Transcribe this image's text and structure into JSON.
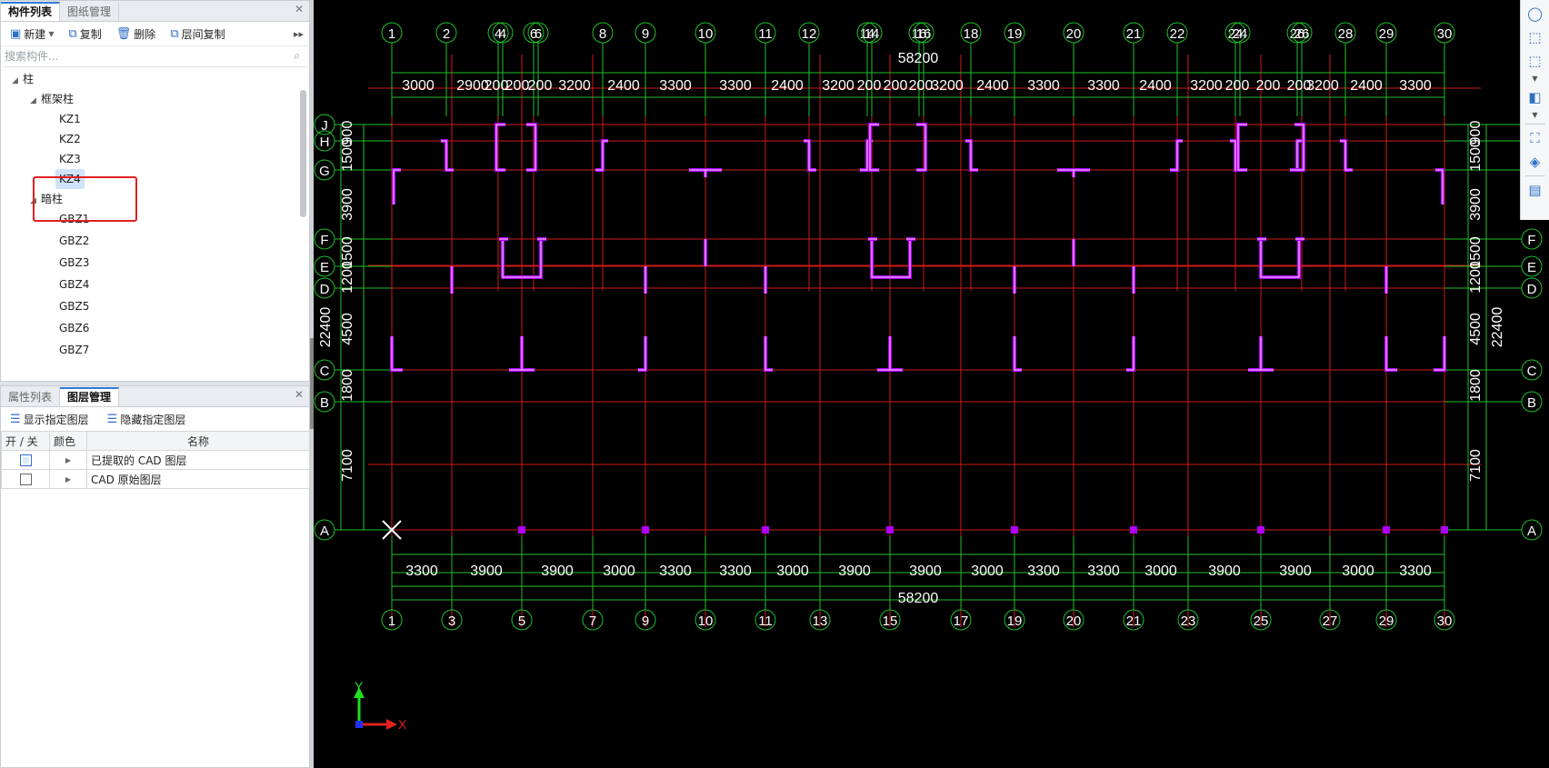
{
  "components_panel": {
    "tabs": [
      "构件列表",
      "图纸管理"
    ],
    "toolbar": {
      "new": "新建",
      "copy": "复制",
      "delete": "删除",
      "floor_copy": "层间复制"
    },
    "search_placeholder": "搜索构件...",
    "tree": {
      "root": "柱",
      "group1": "框架柱",
      "group1_items": [
        "KZ1",
        "KZ2",
        "KZ3",
        "KZ4"
      ],
      "selected": "KZ4",
      "group2": "暗柱",
      "group2_items": [
        "GBZ1",
        "GBZ2",
        "GBZ3",
        "GBZ4",
        "GBZ5",
        "GBZ6",
        "GBZ7"
      ]
    }
  },
  "layer_panel": {
    "tabs": [
      "属性列表",
      "图层管理"
    ],
    "show_btn": "显示指定图层",
    "hide_btn": "隐藏指定图层",
    "headers": [
      "开 / 关",
      "颜色",
      "名称"
    ],
    "rows": [
      {
        "on": true,
        "name": "已提取的 CAD 图层"
      },
      {
        "on": false,
        "name": "CAD 原始图层"
      }
    ]
  },
  "cad": {
    "colors": {
      "grid": "#d11a1a",
      "dim": "#1fbf2a",
      "column": "#b000ff",
      "text": "#ffffff",
      "bg": "#000000"
    },
    "top_axes": [
      "1",
      "2",
      "4",
      "4",
      "6",
      "6",
      "8",
      "9",
      "10",
      "11",
      "12",
      "14",
      "14",
      "16",
      "16",
      "18",
      "19",
      "20",
      "21",
      "22",
      "24",
      "24",
      "26",
      "26",
      "28",
      "29",
      "30"
    ],
    "top_total": "58200",
    "top_dims": [
      "3000",
      "2900",
      "200",
      "200",
      "200",
      "3200",
      "2400",
      "3300",
      "3300",
      "2400",
      "3200",
      "200",
      "200",
      "200",
      "3200",
      "2400",
      "3300",
      "3300",
      "2400",
      "3200",
      "200",
      "200",
      "200",
      "3200",
      "2400",
      "3300"
    ],
    "bottom_axes": [
      "1",
      "3",
      "5",
      "7",
      "9",
      "10",
      "11",
      "13",
      "15",
      "17",
      "19",
      "20",
      "21",
      "23",
      "25",
      "27",
      "29",
      "30"
    ],
    "bottom_dims": [
      "3300",
      "3900",
      "3900",
      "3000",
      "3300",
      "3300",
      "3000",
      "3900",
      "3900",
      "3000",
      "3300",
      "3300",
      "3000",
      "3900",
      "3900",
      "3000",
      "3300"
    ],
    "bottom_total": "58200",
    "rows": [
      "J",
      "H",
      "G",
      "F",
      "E",
      "D",
      "C",
      "B",
      "A"
    ],
    "vert_dims": [
      "900",
      "1500",
      "3900",
      "1500",
      "1200",
      "4500",
      "1800",
      "7100"
    ],
    "vert_total": "22400",
    "ucs": {
      "x": "X",
      "y": "Y"
    }
  },
  "right_toolbar": [
    "3d-orbit-icon",
    "3d-view-icon",
    "box-view-icon",
    "solid-view-icon",
    "fullscreen-icon",
    "layer-view-icon",
    "properties-icon"
  ]
}
